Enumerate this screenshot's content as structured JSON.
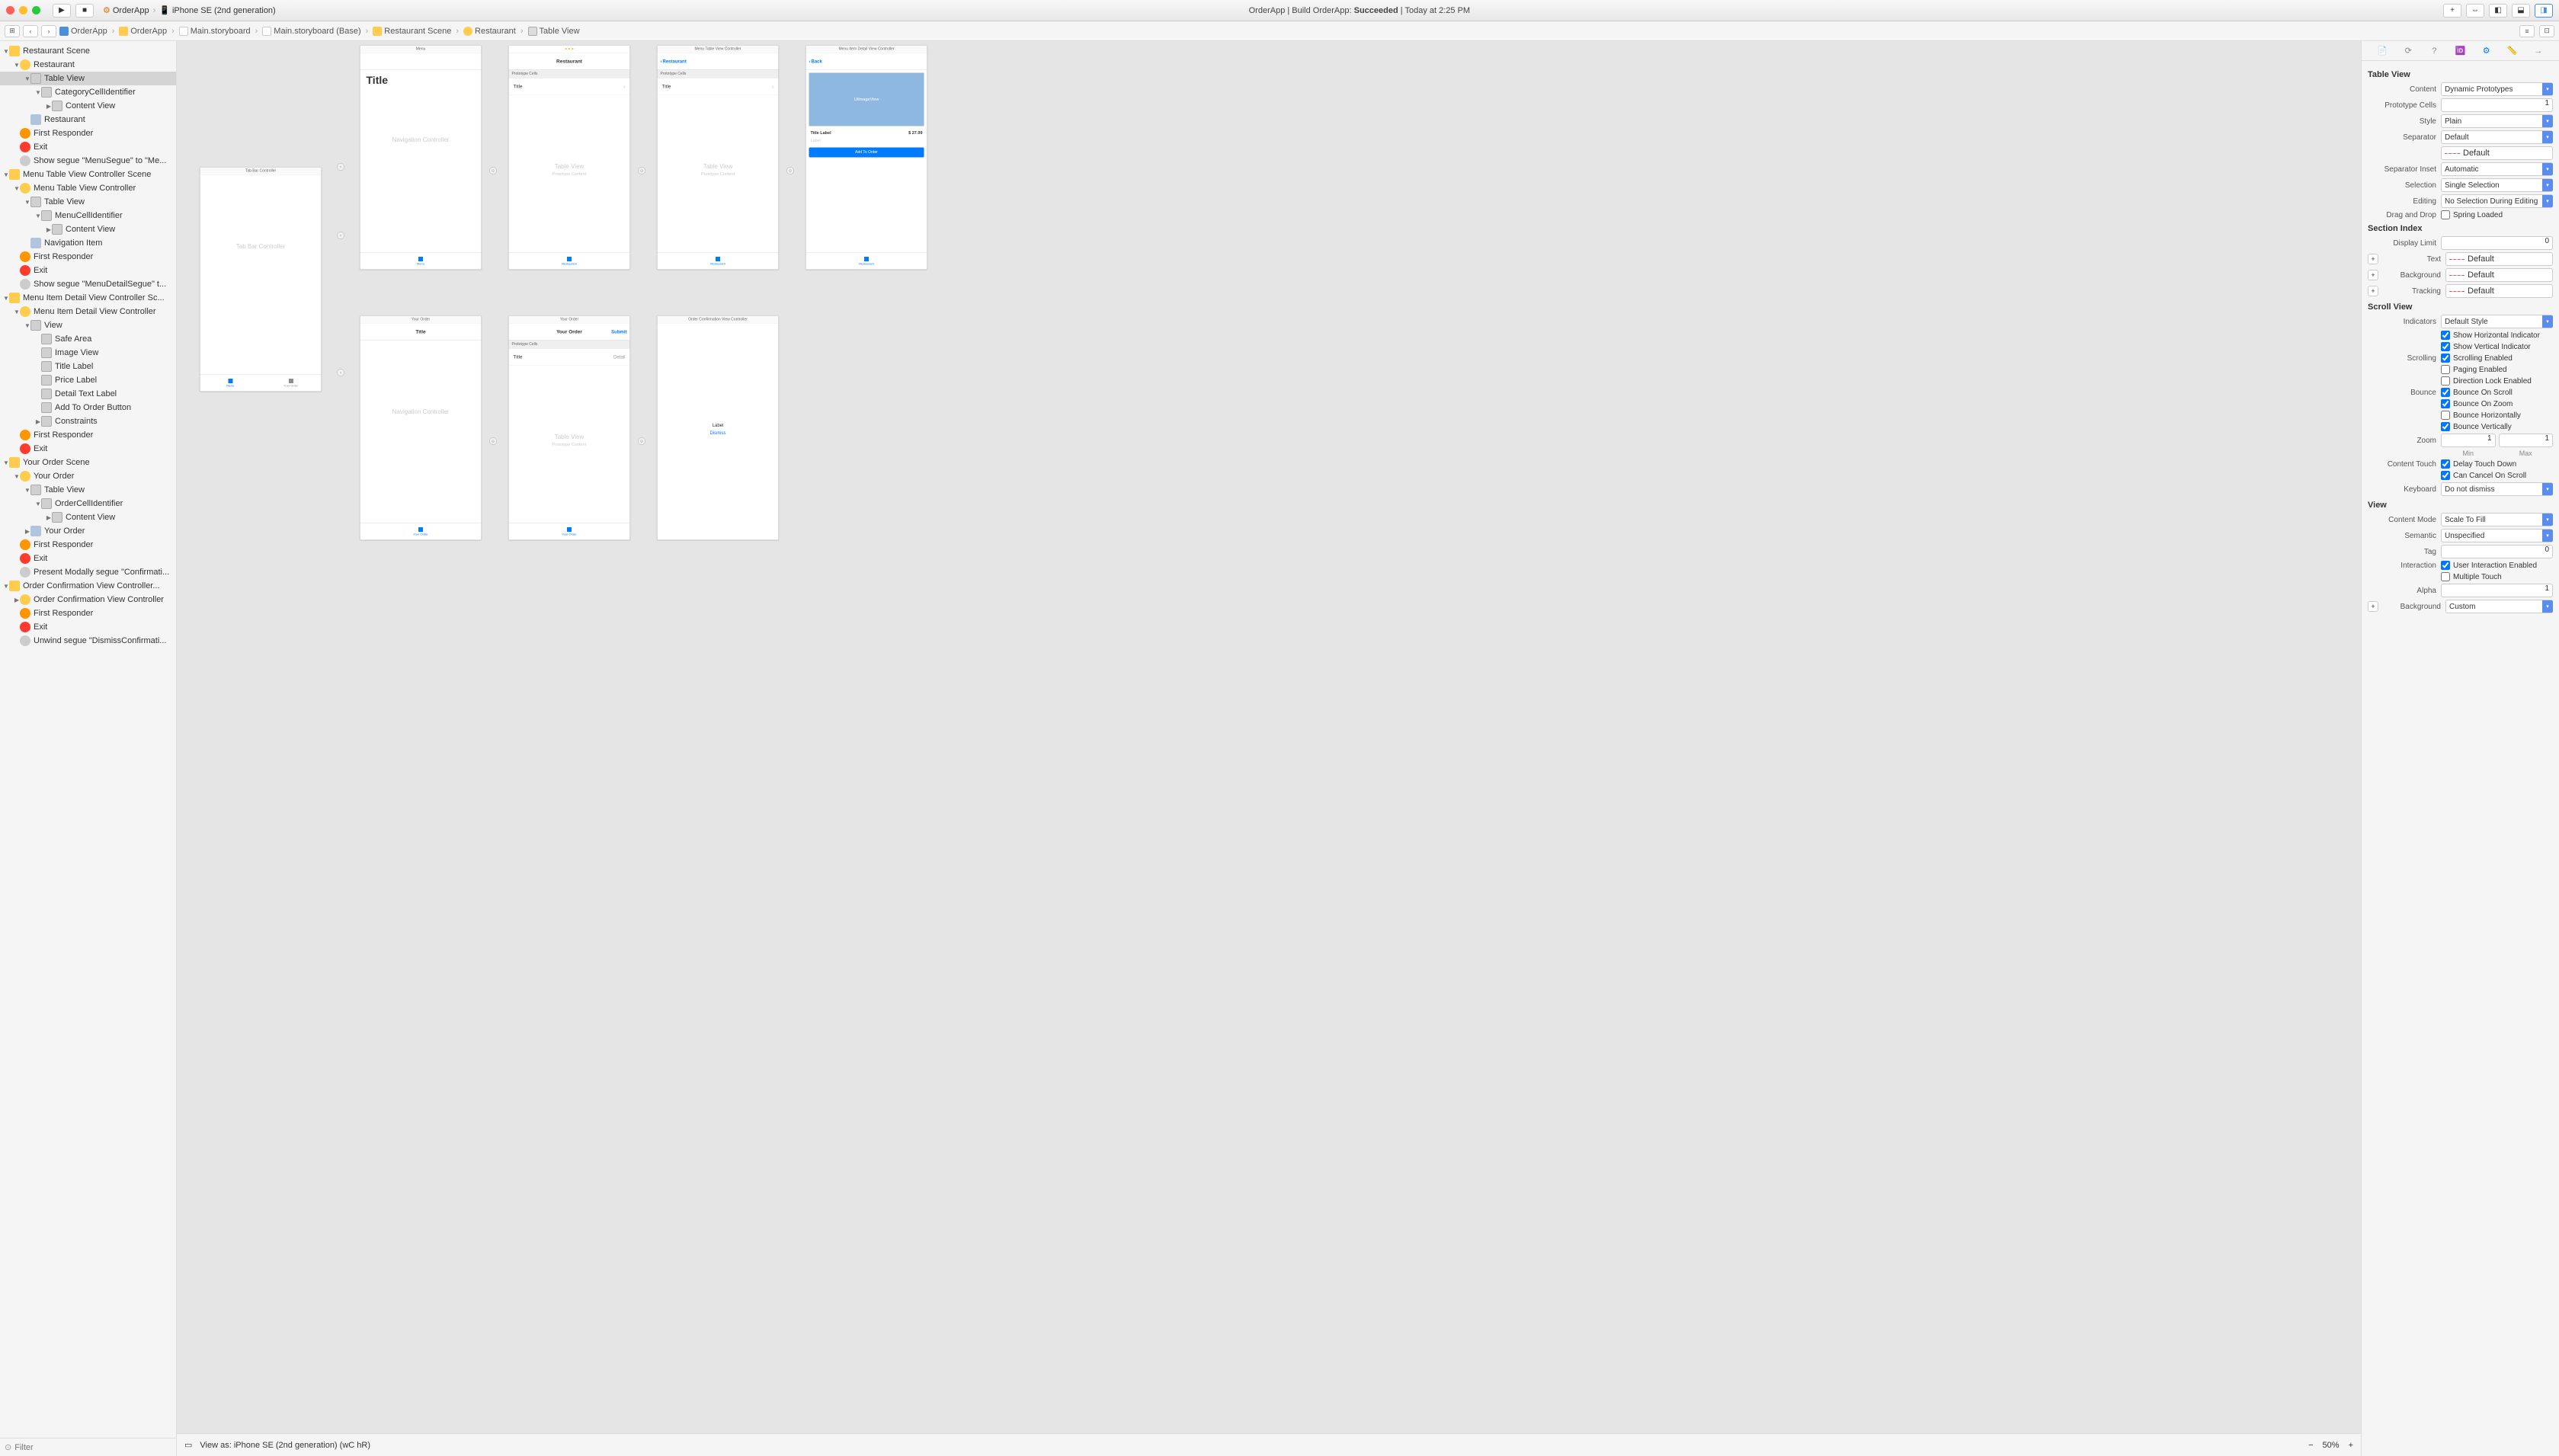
{
  "toolbar": {
    "scheme": "OrderApp",
    "device": "iPhone SE (2nd generation)",
    "status_app": "OrderApp | Build OrderApp:",
    "status_result": "Succeeded",
    "status_time": "| Today at 2:25 PM"
  },
  "breadcrumb": {
    "items": [
      "OrderApp",
      "OrderApp",
      "Main.storyboard",
      "Main.storyboard (Base)",
      "Restaurant Scene",
      "Restaurant",
      "Table View"
    ]
  },
  "outline": [
    {
      "d": 0,
      "i": "scene",
      "t": "Restaurant Scene",
      "tri": "▼"
    },
    {
      "d": 1,
      "i": "vc",
      "t": "Restaurant",
      "tri": "▼"
    },
    {
      "d": 2,
      "i": "view",
      "t": "Table View",
      "tri": "▼",
      "sel": true
    },
    {
      "d": 3,
      "i": "view",
      "t": "CategoryCellIdentifier",
      "tri": "▼"
    },
    {
      "d": 4,
      "i": "view",
      "t": "Content View",
      "tri": "▶"
    },
    {
      "d": 2,
      "i": "nav",
      "t": "Restaurant",
      "tri": ""
    },
    {
      "d": 1,
      "i": "first",
      "t": "First Responder",
      "tri": ""
    },
    {
      "d": 1,
      "i": "exit",
      "t": "Exit",
      "tri": ""
    },
    {
      "d": 1,
      "i": "segue",
      "t": "Show segue \"MenuSegue\" to \"Me...",
      "tri": ""
    },
    {
      "d": 0,
      "i": "scene",
      "t": "Menu Table View Controller Scene",
      "tri": "▼"
    },
    {
      "d": 1,
      "i": "vc",
      "t": "Menu Table View Controller",
      "tri": "▼"
    },
    {
      "d": 2,
      "i": "view",
      "t": "Table View",
      "tri": "▼"
    },
    {
      "d": 3,
      "i": "view",
      "t": "MenuCellIdentifier",
      "tri": "▼"
    },
    {
      "d": 4,
      "i": "view",
      "t": "Content View",
      "tri": "▶"
    },
    {
      "d": 2,
      "i": "nav",
      "t": "Navigation Item",
      "tri": ""
    },
    {
      "d": 1,
      "i": "first",
      "t": "First Responder",
      "tri": ""
    },
    {
      "d": 1,
      "i": "exit",
      "t": "Exit",
      "tri": ""
    },
    {
      "d": 1,
      "i": "segue",
      "t": "Show segue \"MenuDetailSegue\" t...",
      "tri": ""
    },
    {
      "d": 0,
      "i": "scene",
      "t": "Menu Item Detail View Controller Sc...",
      "tri": "▼"
    },
    {
      "d": 1,
      "i": "vc",
      "t": "Menu Item Detail View Controller",
      "tri": "▼"
    },
    {
      "d": 2,
      "i": "view",
      "t": "View",
      "tri": "▼"
    },
    {
      "d": 3,
      "i": "view",
      "t": "Safe Area",
      "tri": ""
    },
    {
      "d": 3,
      "i": "view",
      "t": "Image View",
      "tri": ""
    },
    {
      "d": 3,
      "i": "view",
      "t": "Title Label",
      "tri": ""
    },
    {
      "d": 3,
      "i": "view",
      "t": "Price Label",
      "tri": ""
    },
    {
      "d": 3,
      "i": "view",
      "t": "Detail Text Label",
      "tri": ""
    },
    {
      "d": 3,
      "i": "view",
      "t": "Add To Order Button",
      "tri": ""
    },
    {
      "d": 3,
      "i": "view",
      "t": "Constraints",
      "tri": "▶"
    },
    {
      "d": 1,
      "i": "first",
      "t": "First Responder",
      "tri": ""
    },
    {
      "d": 1,
      "i": "exit",
      "t": "Exit",
      "tri": ""
    },
    {
      "d": 0,
      "i": "scene",
      "t": "Your Order Scene",
      "tri": "▼"
    },
    {
      "d": 1,
      "i": "vc",
      "t": "Your Order",
      "tri": "▼"
    },
    {
      "d": 2,
      "i": "view",
      "t": "Table View",
      "tri": "▼"
    },
    {
      "d": 3,
      "i": "view",
      "t": "OrderCellIdentifier",
      "tri": "▼"
    },
    {
      "d": 4,
      "i": "view",
      "t": "Content View",
      "tri": "▶"
    },
    {
      "d": 2,
      "i": "nav",
      "t": "Your Order",
      "tri": "▶"
    },
    {
      "d": 1,
      "i": "first",
      "t": "First Responder",
      "tri": ""
    },
    {
      "d": 1,
      "i": "exit",
      "t": "Exit",
      "tri": ""
    },
    {
      "d": 1,
      "i": "segue",
      "t": "Present Modally segue \"Confirmati...",
      "tri": ""
    },
    {
      "d": 0,
      "i": "scene",
      "t": "Order Confirmation View Controller...",
      "tri": "▼"
    },
    {
      "d": 1,
      "i": "vc",
      "t": "Order Confirmation View Controller",
      "tri": "▶"
    },
    {
      "d": 1,
      "i": "first",
      "t": "First Responder",
      "tri": ""
    },
    {
      "d": 1,
      "i": "exit",
      "t": "Exit",
      "tri": ""
    },
    {
      "d": 1,
      "i": "segue",
      "t": "Unwind segue \"DismissConfirmati...",
      "tri": ""
    }
  ],
  "filter_placeholder": "Filter",
  "canvas": {
    "tabbar": {
      "title": "Tab Bar Controller",
      "body": "Tab Bar Controller",
      "tab1": "Menu",
      "tab2": "Your Order"
    },
    "nav1": {
      "title": "Menu",
      "body": "Navigation Controller",
      "bigtitle": "Title"
    },
    "nav2": {
      "title": "Your Order",
      "body": "Navigation Controller",
      "cell": "Title"
    },
    "restaurant": {
      "title": "Restaurant",
      "proto": "Prototype Cells",
      "cell": "Title",
      "placeholder": "Table View",
      "sub": "Prototype Content",
      "tab": "Restaurant"
    },
    "menu": {
      "title": "Menu Table View Controller",
      "back": "Restaurant",
      "proto": "Prototype Cells",
      "cell": "Title",
      "placeholder": "Table View",
      "sub": "Prototype Content",
      "tab": "Restaurant"
    },
    "order": {
      "title": "Your Order",
      "nav": "Your Order",
      "submit": "Submit",
      "proto": "Prototype Cells",
      "cell": "Title",
      "detail": "Detail",
      "placeholder": "Table View",
      "sub": "Prototype Content",
      "tab": "Your Order"
    },
    "detail": {
      "title": "Menu Item Detail View Controller",
      "back": "Back",
      "img": "UIImageView",
      "titlelabel": "Title Label",
      "price": "$ 27.99",
      "label": "Label",
      "add": "Add To Order",
      "tab": "Restaurant"
    },
    "confirm": {
      "title": "Order Confirmation View Controller",
      "label": "Label",
      "dismiss": "Dismiss"
    }
  },
  "canvas_bottom": {
    "viewas": "View as: iPhone SE (2nd generation) (wC hR)",
    "zoom": "50%"
  },
  "inspector": {
    "tableview": {
      "header": "Table View",
      "content_label": "Content",
      "content": "Dynamic Prototypes",
      "proto_label": "Prototype Cells",
      "proto": "1",
      "style_label": "Style",
      "style": "Plain",
      "separator_label": "Separator",
      "separator": "Default",
      "separator_color": "Default",
      "inset_label": "Separator Inset",
      "inset": "Automatic",
      "selection_label": "Selection",
      "selection": "Single Selection",
      "editing_label": "Editing",
      "editing": "No Selection During Editing",
      "dragdrop_label": "Drag and Drop",
      "spring": "Spring Loaded"
    },
    "sectionindex": {
      "header": "Section Index",
      "display_label": "Display Limit",
      "display": "0",
      "text_label": "Text",
      "text": "Default",
      "bg_label": "Background",
      "bg": "Default",
      "track_label": "Tracking",
      "track": "Default"
    },
    "scrollview": {
      "header": "Scroll View",
      "ind_label": "Indicators",
      "ind": "Default Style",
      "show_h": "Show Horizontal Indicator",
      "show_v": "Show Vertical Indicator",
      "scroll_label": "Scrolling",
      "scroll_en": "Scrolling Enabled",
      "paging": "Paging Enabled",
      "dirlock": "Direction Lock Enabled",
      "bounce_label": "Bounce",
      "b_scroll": "Bounce On Scroll",
      "b_zoom": "Bounce On Zoom",
      "b_h": "Bounce Horizontally",
      "b_v": "Bounce Vertically",
      "zoom_label": "Zoom",
      "zoom_min": "1",
      "zoom_max": "1",
      "min": "Min",
      "max": "Max",
      "touch_label": "Content Touch",
      "delay": "Delay Touch Down",
      "cancel": "Can Cancel On Scroll",
      "kb_label": "Keyboard",
      "kb": "Do not dismiss"
    },
    "view": {
      "header": "View",
      "mode_label": "Content Mode",
      "mode": "Scale To Fill",
      "sem_label": "Semantic",
      "sem": "Unspecified",
      "tag_label": "Tag",
      "tag": "0",
      "inter_label": "Interaction",
      "user": "User Interaction Enabled",
      "multi": "Multiple Touch",
      "alpha_label": "Alpha",
      "alpha": "1",
      "bg_label": "Background",
      "bg": "Custom"
    }
  }
}
